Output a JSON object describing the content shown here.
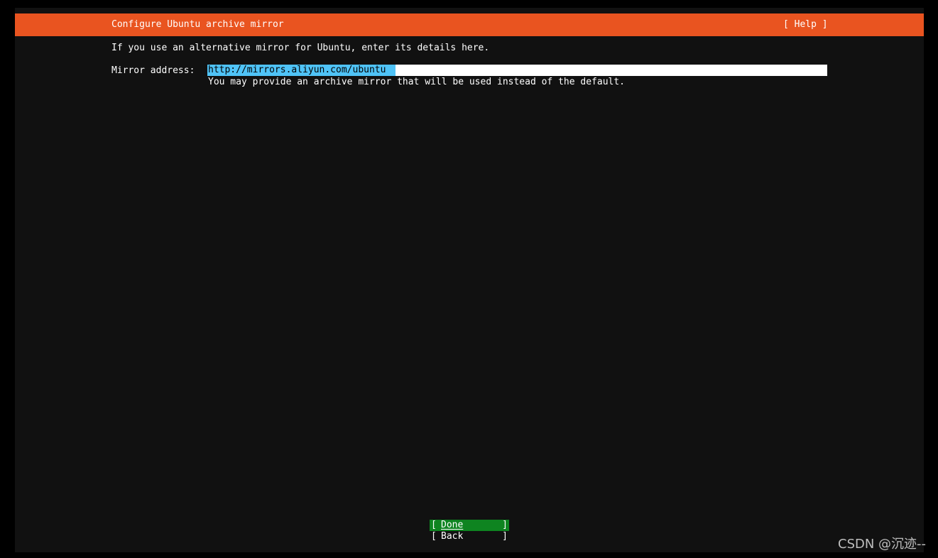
{
  "header": {
    "title": "Configure Ubuntu archive mirror",
    "help_label": "[ Help ]"
  },
  "main": {
    "intro": "If you use an alternative mirror for Ubuntu, enter its details here.",
    "mirror_field": {
      "label": "Mirror address:",
      "value": "http://mirrors.aliyun.com/ubuntu",
      "help": "You may provide an archive mirror that will be used instead of the default."
    }
  },
  "buttons": {
    "done": {
      "open": "[",
      "label": "Done",
      "close": "]"
    },
    "back": {
      "open": "[",
      "label": "Back",
      "close": "]"
    }
  },
  "watermark": "CSDN @沉迹--",
  "colors": {
    "title_bar": "#E95420",
    "background": "#111111",
    "selection": "#4FC3F7",
    "done_button": "#0E8420"
  }
}
